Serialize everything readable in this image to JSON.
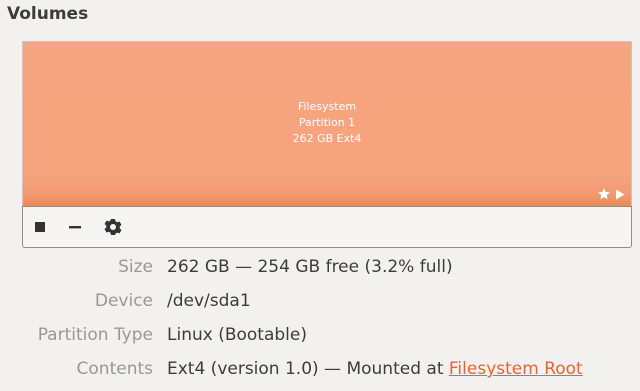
{
  "volumes": {
    "title": "Volumes",
    "partition": {
      "line1": "Filesystem",
      "line2": "Partition 1",
      "line3": "262 GB Ext4",
      "flags": [
        "star-icon",
        "play-icon"
      ]
    },
    "toolbar": {
      "buttons": [
        "stop-icon",
        "minus-icon",
        "gear-icon"
      ]
    }
  },
  "details": {
    "size": {
      "label": "Size",
      "value": "262 GB — 254 GB free (3.2% full)"
    },
    "device": {
      "label": "Device",
      "value": "/dev/sda1"
    },
    "partition_type": {
      "label": "Partition Type",
      "value": "Linux (Bootable)"
    },
    "contents": {
      "label": "Contents",
      "value_prefix": "Ext4 (version 1.0) — Mounted at ",
      "link_text": "Filesystem Root"
    }
  },
  "colors": {
    "partition_fill": "#f5a57f",
    "accent_link": "#e9632d",
    "label_gray": "#9a9794",
    "background": "#f2f1f0"
  }
}
